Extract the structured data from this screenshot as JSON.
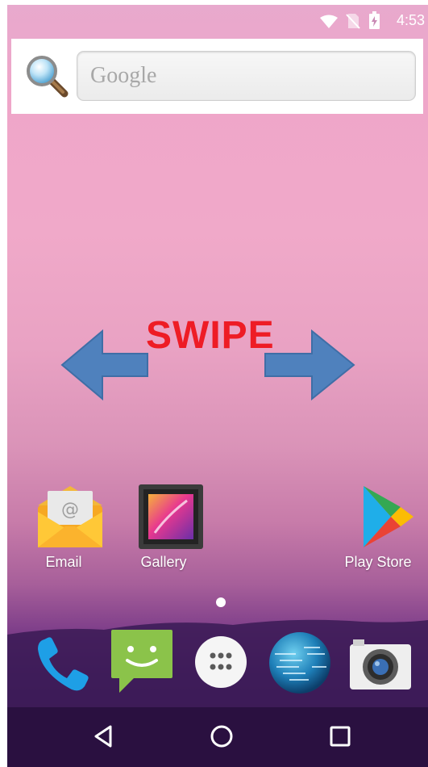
{
  "status_bar": {
    "time": "4:53",
    "icons": [
      "wifi-icon",
      "no-sim-icon",
      "battery-charging-icon"
    ]
  },
  "search": {
    "placeholder": "Google",
    "icon": "magnifier-icon"
  },
  "wallpaper_overlay": {
    "text": "SWIPE",
    "text_color": "#ee1c25",
    "arrow_color": "#4f81bd"
  },
  "home_apps": [
    {
      "label": "Email",
      "icon": "email-icon"
    },
    {
      "label": "Gallery",
      "icon": "gallery-icon"
    },
    {
      "label": "Play Store",
      "icon": "play-store-icon"
    }
  ],
  "page_indicator": {
    "pages": 1,
    "current": 1
  },
  "dock": [
    {
      "icon": "phone-icon"
    },
    {
      "icon": "messaging-icon"
    },
    {
      "icon": "all-apps-icon"
    },
    {
      "icon": "browser-globe-icon"
    },
    {
      "icon": "camera-icon"
    }
  ],
  "nav_bar": [
    "back-icon",
    "home-icon",
    "recents-icon"
  ]
}
